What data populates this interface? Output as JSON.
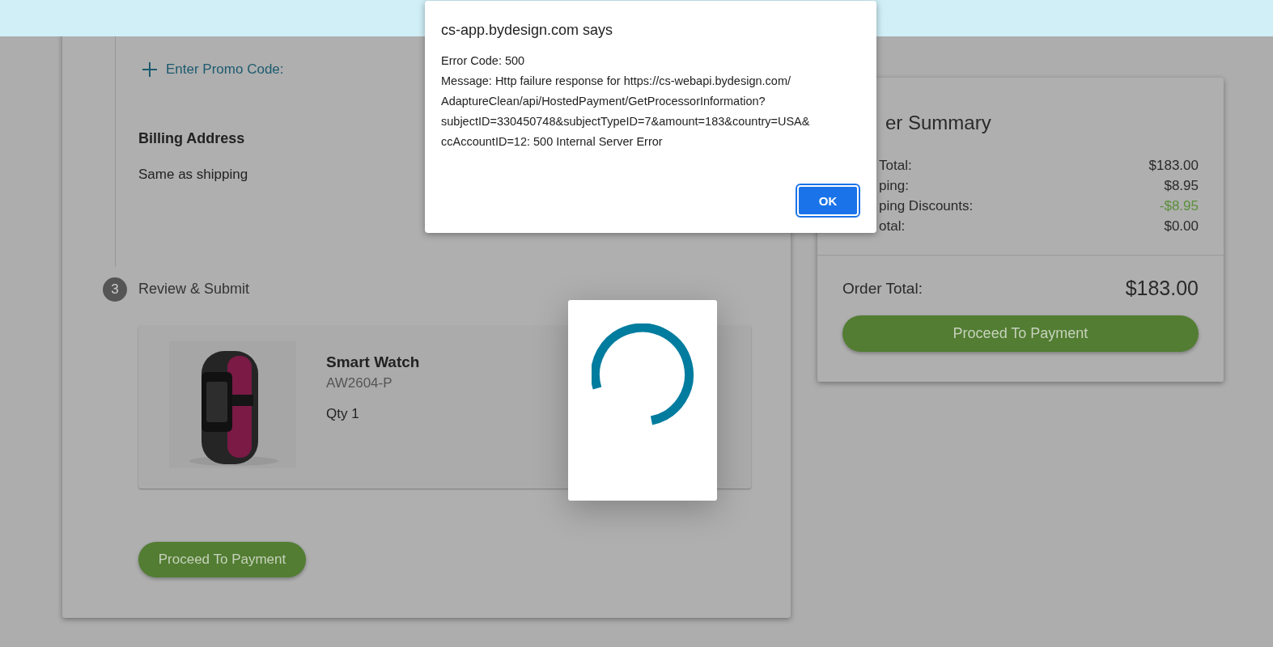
{
  "checkout": {
    "promo": {
      "label": "Enter Promo Code:"
    },
    "billing": {
      "heading": "Billing Address",
      "value": "Same as shipping"
    },
    "step": {
      "number": "3",
      "title": "Review & Submit"
    },
    "product": {
      "name": "Smart Watch",
      "sku": "AW2604-P",
      "quantity": "Qty 1"
    },
    "button": "Proceed To Payment"
  },
  "summary": {
    "title": "er Summary",
    "rows": [
      {
        "label": "Total:",
        "value": "$183.00",
        "kind": "normal"
      },
      {
        "label": "ping:",
        "value": "$8.95",
        "kind": "normal"
      },
      {
        "label": "ping Discounts:",
        "value": "-$8.95",
        "kind": "discount"
      },
      {
        "label": "otal:",
        "value": "$0.00",
        "kind": "normal"
      }
    ],
    "total_label": "Order Total:",
    "total_value": "$183.00",
    "button": "Proceed To Payment"
  },
  "dialog": {
    "title": "cs-app.bydesign.com says",
    "lines": [
      "Error Code: 500",
      "Message: Http failure response for https://cs-webapi.bydesign.com/",
      "AdaptureClean/api/HostedPayment/GetProcessorInformation?",
      "subjectID=330450748&subjectTypeID=7&amount=183&country=USA&",
      "ccAccountID=12: 500 Internal Server Error"
    ],
    "button": "OK"
  }
}
